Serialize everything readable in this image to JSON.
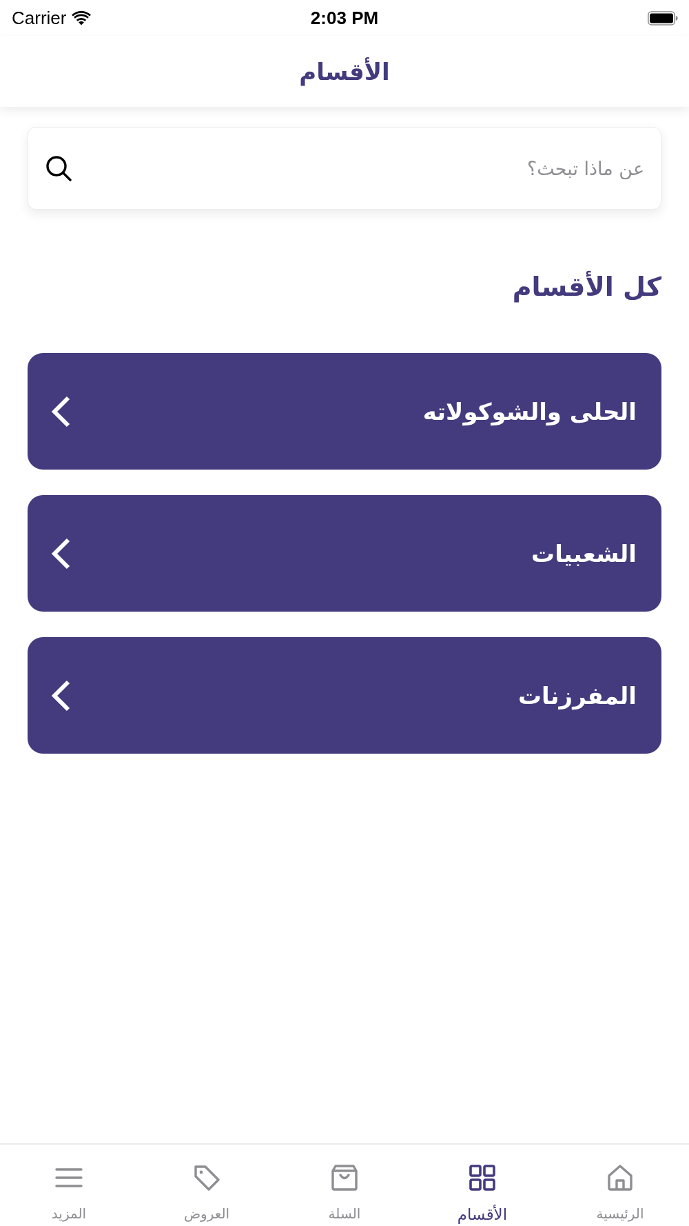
{
  "status_bar": {
    "carrier": "Carrier",
    "time": "2:03 PM"
  },
  "header": {
    "title": "الأقسام"
  },
  "search": {
    "placeholder": "عن ماذا تبحث؟"
  },
  "section": {
    "title": "كل الأقسام"
  },
  "categories": [
    {
      "name": "الحلى والشوكولاته"
    },
    {
      "name": "الشعبيات"
    },
    {
      "name": "المفرزنات"
    }
  ],
  "tab_bar": [
    {
      "label": "الرئيسية",
      "kind": "home",
      "selected": false
    },
    {
      "label": "الأقسام",
      "kind": "grid",
      "selected": true
    },
    {
      "label": "السلة",
      "kind": "bag",
      "selected": false
    },
    {
      "label": "العروض",
      "kind": "tag",
      "selected": false
    },
    {
      "label": "المزيد",
      "kind": "menu",
      "selected": false
    }
  ]
}
